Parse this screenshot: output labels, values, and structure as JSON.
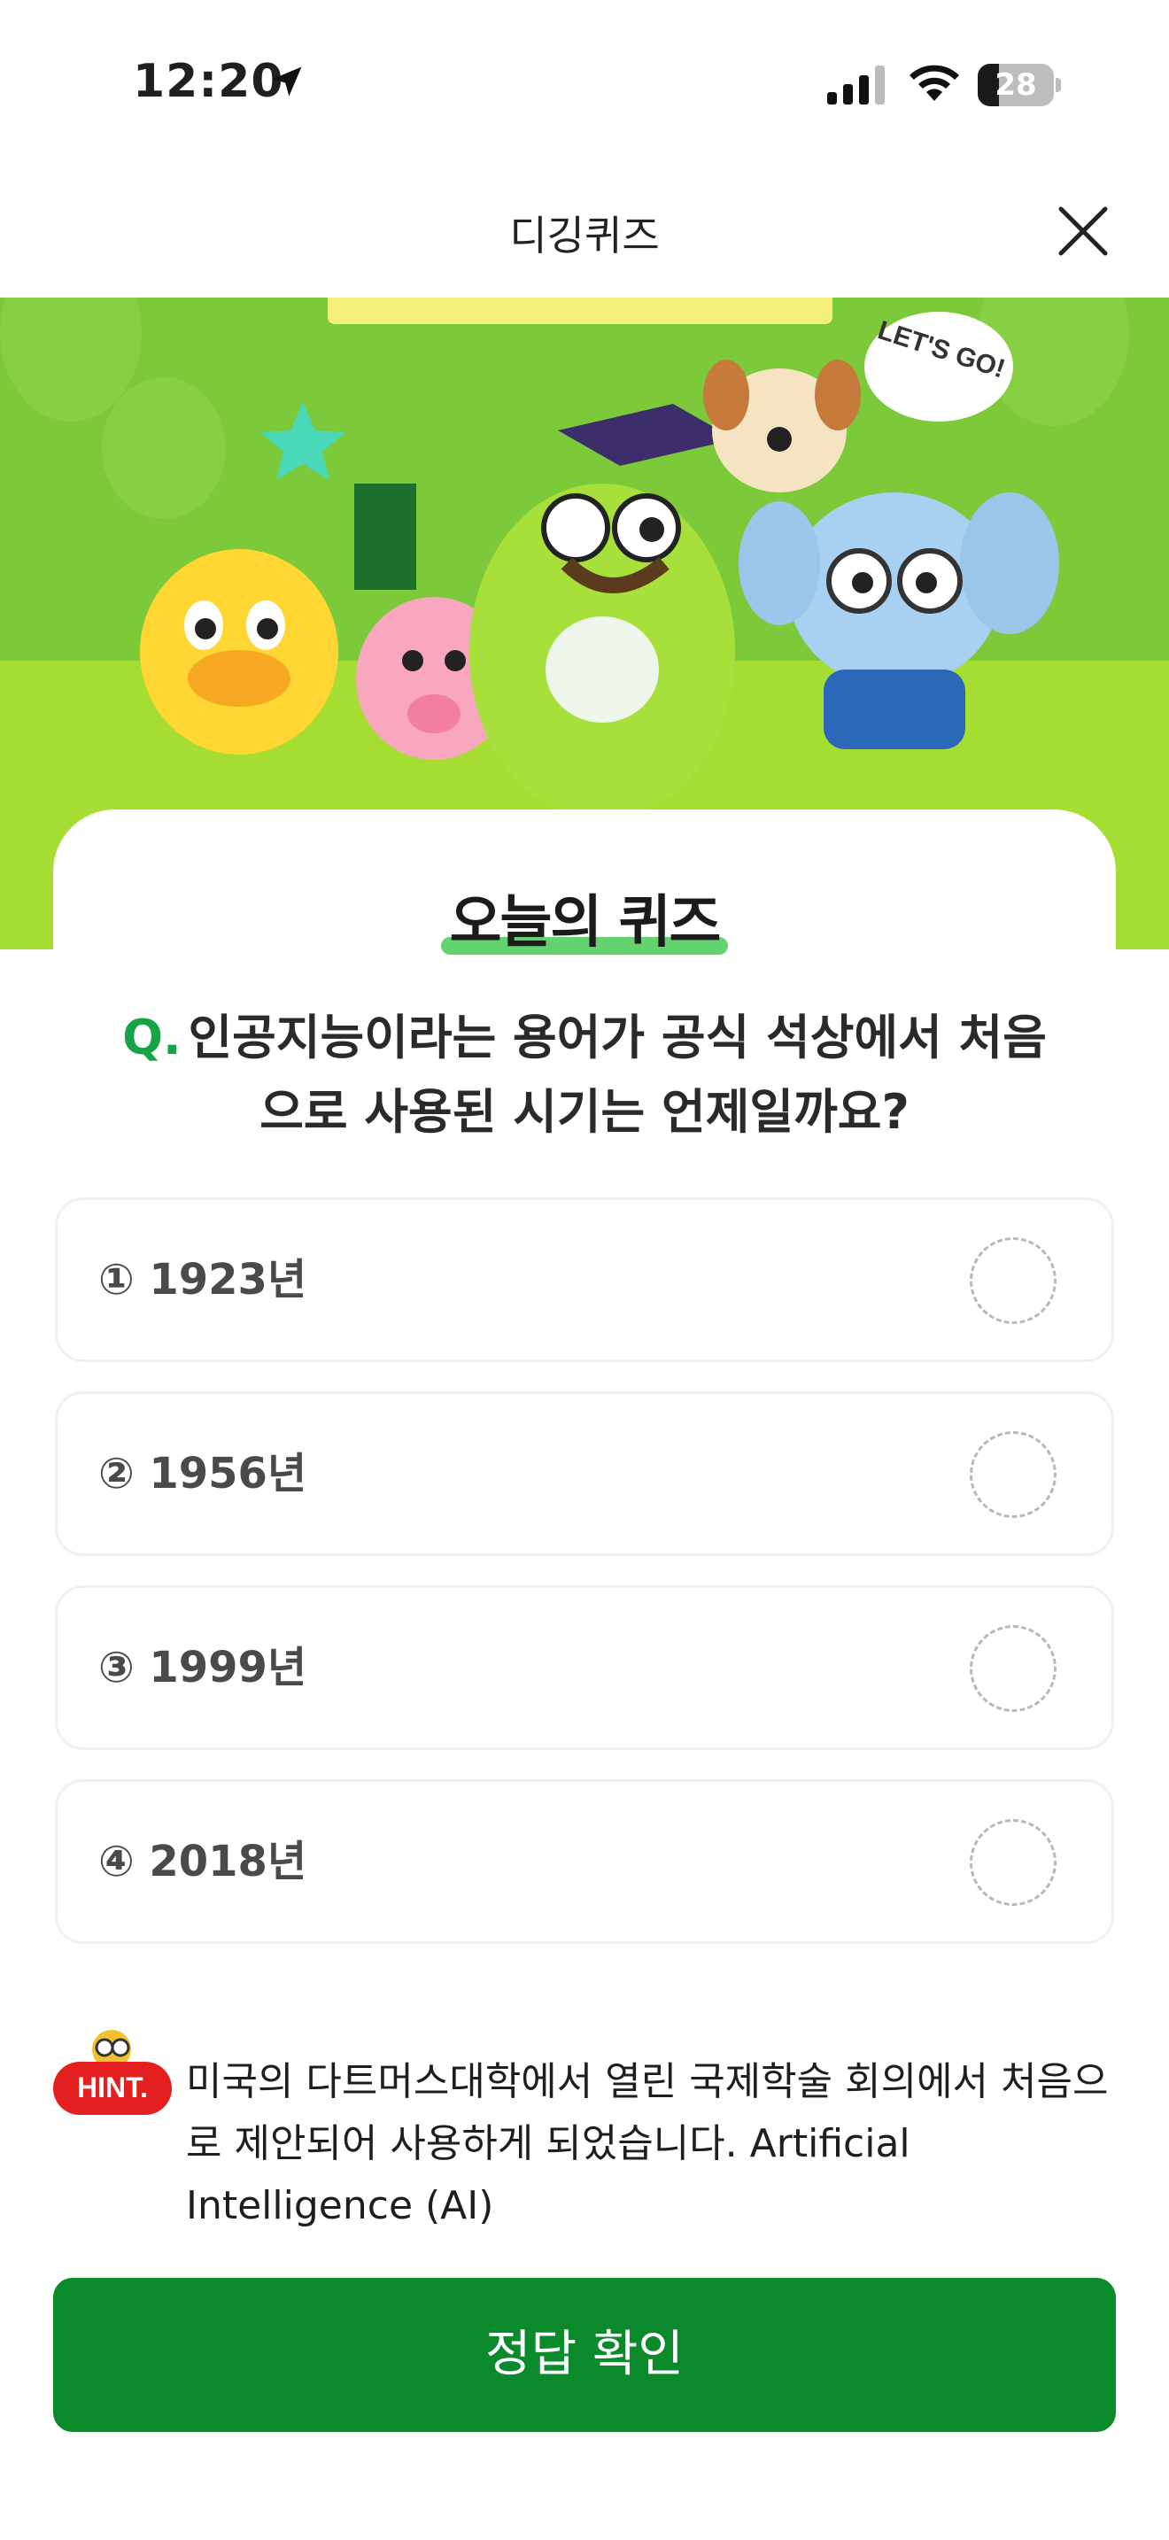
{
  "status_bar": {
    "time": "12:20",
    "battery": "28",
    "battery_level": 0.28,
    "icons": [
      "location-arrow-icon",
      "cellular-signal-icon",
      "wifi-icon",
      "battery-icon"
    ]
  },
  "nav": {
    "title": "디깅퀴즈",
    "close_icon": "close-icon"
  },
  "banner": {
    "bubble_text": "LET'S GO!"
  },
  "quiz": {
    "title": "오늘의 퀴즈",
    "question_prefix": "Q.",
    "question": "인공지능이라는 용어가 공식 석상에서 처음으로 사용된 시기는 언제일까요?",
    "options": [
      {
        "label": "① 1923년"
      },
      {
        "label": "② 1956년"
      },
      {
        "label": "③ 1999년"
      },
      {
        "label": "④ 2018년"
      }
    ]
  },
  "hint": {
    "badge": "HINT.",
    "text": "미국의 다트머스대학에서 열린 국제학술 회의에서 처음으로 제안되어 사용하게 되었습니다. Artificial Intelligence (AI)"
  },
  "submit": {
    "label": "정답 확인"
  },
  "colors": {
    "accent_green": "#0b8a2c",
    "question_prefix": "#17a447",
    "banner_bg": "#a6dd33",
    "hint_badge": "#e41f1f"
  }
}
